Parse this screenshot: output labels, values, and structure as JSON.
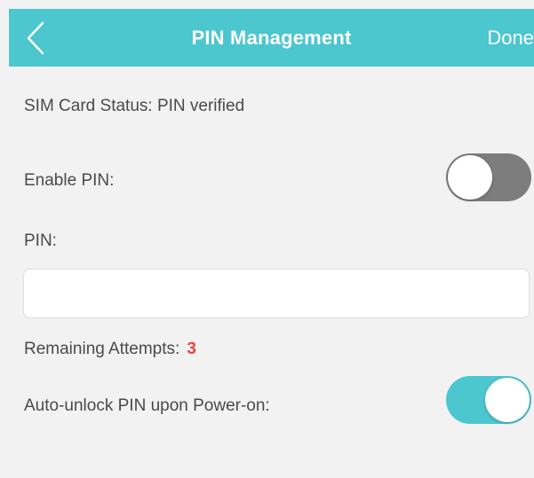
{
  "header": {
    "title": "PIN Management",
    "done_label": "Done"
  },
  "sim_status": {
    "text": "SIM Card Status: PIN verified"
  },
  "enable_pin": {
    "label": "Enable PIN:",
    "state": "off"
  },
  "pin": {
    "label": "PIN:",
    "value": "",
    "placeholder": ""
  },
  "attempts": {
    "label": "Remaining Attempts:",
    "value": "3"
  },
  "auto_unlock": {
    "label": "Auto-unlock PIN upon Power-on:",
    "state": "on"
  },
  "colors": {
    "accent": "#4cc6cf",
    "toggle_off": "#7d7d7d",
    "attempts_value": "#e8473e",
    "background": "#f2f2f2"
  }
}
